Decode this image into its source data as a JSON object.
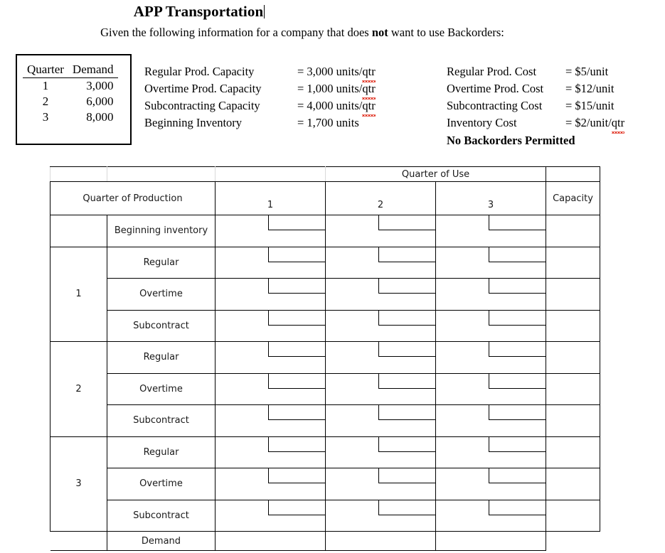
{
  "document": {
    "title": "APP Transportation",
    "subtitle_before": "Given the following information for a company that does ",
    "subtitle_bold": "not",
    "subtitle_after": " want to use Backorders:"
  },
  "demand_box": {
    "headers": [
      "Quarter",
      "Demand"
    ],
    "rows": [
      {
        "quarter": "1",
        "demand": "3,000"
      },
      {
        "quarter": "2",
        "demand": "6,000"
      },
      {
        "quarter": "3",
        "demand": "8,000"
      }
    ]
  },
  "capacity_info": [
    {
      "label": "Regular Prod. Capacity",
      "value_prefix": "= 3,000 units/",
      "value_suffix": "qtr"
    },
    {
      "label": "Overtime Prod. Capacity",
      "value_prefix": "= 1,000 units/",
      "value_suffix": "qtr"
    },
    {
      "label": "Subcontracting Capacity",
      "value_prefix": "= 4,000 units/",
      "value_suffix": "qtr"
    },
    {
      "label": "Beginning Inventory",
      "value_prefix": "= 1,700 units",
      "value_suffix": ""
    }
  ],
  "cost_info": [
    {
      "label": "Regular Prod. Cost",
      "value_prefix": "= $5/unit",
      "value_suffix": ""
    },
    {
      "label": "Overtime Prod. Cost",
      "value_prefix": "= $12/unit",
      "value_suffix": ""
    },
    {
      "label": "Subcontracting Cost",
      "value_prefix": "= $15/unit",
      "value_suffix": ""
    },
    {
      "label": "Inventory Cost",
      "value_prefix": "= $2/unit/",
      "value_suffix": "qtr"
    }
  ],
  "no_backorders_note": "No Backorders Permitted",
  "tableau": {
    "header_quarter_of_use": "Quarter of Use",
    "header_quarter_of_production": "Quarter of Production",
    "header_capacity": "Capacity",
    "use_columns": [
      "1",
      "2",
      "3"
    ],
    "rows": [
      {
        "group": "",
        "label": "Beginning inventory",
        "cells": [
          "",
          "",
          ""
        ],
        "capacity": ""
      },
      {
        "group": "1",
        "label": "Regular",
        "cells": [
          "",
          "",
          ""
        ],
        "capacity": ""
      },
      {
        "group": "1",
        "label": "Overtime",
        "cells": [
          "",
          "",
          ""
        ],
        "capacity": ""
      },
      {
        "group": "1",
        "label": "Subcontract",
        "cells": [
          "",
          "",
          ""
        ],
        "capacity": ""
      },
      {
        "group": "2",
        "label": "Regular",
        "cells": [
          "",
          "",
          ""
        ],
        "capacity": ""
      },
      {
        "group": "2",
        "label": "Overtime",
        "cells": [
          "",
          "",
          ""
        ],
        "capacity": ""
      },
      {
        "group": "2",
        "label": "Subcontract",
        "cells": [
          "",
          "",
          ""
        ],
        "capacity": ""
      },
      {
        "group": "3",
        "label": "Regular",
        "cells": [
          "",
          "",
          ""
        ],
        "capacity": ""
      },
      {
        "group": "3",
        "label": "Overtime",
        "cells": [
          "",
          "",
          ""
        ],
        "capacity": ""
      },
      {
        "group": "3",
        "label": "Subcontract",
        "cells": [
          "",
          "",
          ""
        ],
        "capacity": ""
      }
    ],
    "demand_row_label": "Demand",
    "demand_row_cells": [
      "",
      "",
      ""
    ],
    "demand_row_capacity": ""
  },
  "colors": {
    "text": "#000000",
    "border": "#000000",
    "light_border": "#d9d9d9",
    "spellcheck_underline": "#e03020"
  }
}
